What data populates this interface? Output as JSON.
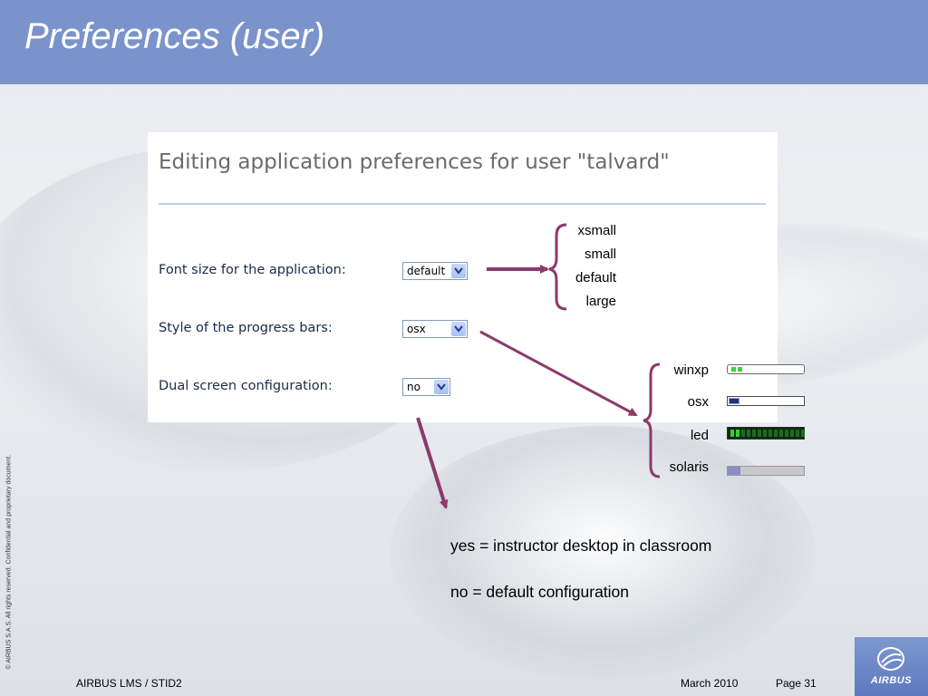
{
  "slide": {
    "title": "Preferences (user)"
  },
  "panel": {
    "heading": "Editing application preferences for user \"talvard\"",
    "rows": [
      {
        "label": "Font size for the application:",
        "value": "default"
      },
      {
        "label": "Style of the progress bars:",
        "value": "osx"
      },
      {
        "label": "Dual screen configuration:",
        "value": "no"
      }
    ]
  },
  "font_size_options": [
    "xsmall",
    "small",
    "default",
    "large"
  ],
  "progress_bar_styles": [
    "winxp",
    "osx",
    "led",
    "solaris"
  ],
  "dual_screen_notes": {
    "yes": "yes =  instructor desktop in classroom",
    "no": "no =  default configuration"
  },
  "footer": {
    "left": "AIRBUS LMS / STID2",
    "date": "March 2010",
    "page": "Page 31",
    "copyright": "© AIRBUS S.A.S. All rights reserved. Confidential and proprietary document.",
    "logo": "AIRBUS"
  },
  "colors": {
    "header_bg": "#7b93cb",
    "arrow": "#8b3a6b",
    "led_on": "#2fd12f"
  }
}
